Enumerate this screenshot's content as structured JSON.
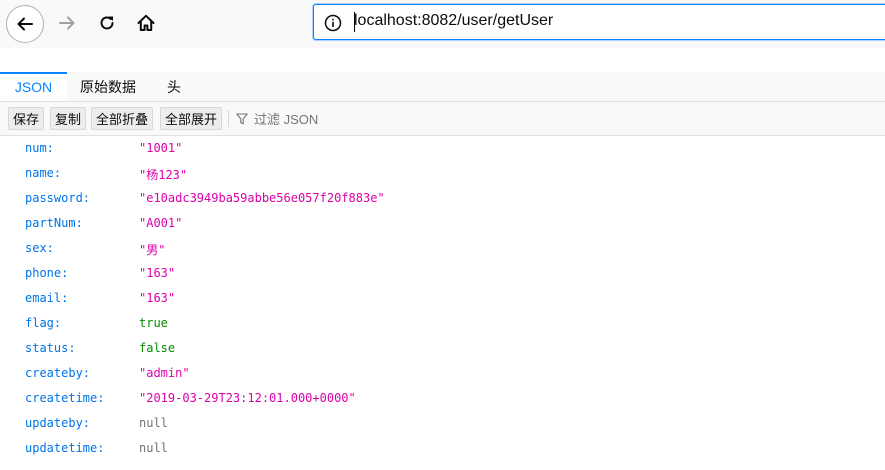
{
  "browser": {
    "url": "localhost:8082/user/getUser"
  },
  "viewer": {
    "tabs": [
      {
        "label": "JSON"
      },
      {
        "label": "原始数据"
      },
      {
        "label": "头"
      }
    ],
    "toolbar": {
      "save_label": "保存",
      "copy_label": "复制",
      "collapse_all_label": "全部折叠",
      "expand_all_label": "全部展开",
      "filter_placeholder": "过滤 JSON"
    }
  },
  "json_rows": [
    {
      "key": "num:",
      "value": "\"1001\"",
      "type": "string"
    },
    {
      "key": "name:",
      "value": "\"杨123\"",
      "type": "string"
    },
    {
      "key": "password:",
      "value": "\"e10adc3949ba59abbe56e057f20f883e\"",
      "type": "string"
    },
    {
      "key": "partNum:",
      "value": "\"A001\"",
      "type": "string"
    },
    {
      "key": "sex:",
      "value": "\"男\"",
      "type": "string"
    },
    {
      "key": "phone:",
      "value": "\"163\"",
      "type": "string"
    },
    {
      "key": "email:",
      "value": "\"163\"",
      "type": "string"
    },
    {
      "key": "flag:",
      "value": "true",
      "type": "bool"
    },
    {
      "key": "status:",
      "value": "false",
      "type": "bool"
    },
    {
      "key": "createby:",
      "value": "\"admin\"",
      "type": "string"
    },
    {
      "key": "createtime:",
      "value": "\"2019-03-29T23:12:01.000+0000\"",
      "type": "string"
    },
    {
      "key": "updateby:",
      "value": "null",
      "type": "null"
    },
    {
      "key": "updatetime:",
      "value": "null",
      "type": "null"
    }
  ],
  "colors": {
    "key": "#0074e8",
    "string": "#dd00a9",
    "bool": "#058b00",
    "null": "#737373",
    "accent": "#0a84ff"
  }
}
